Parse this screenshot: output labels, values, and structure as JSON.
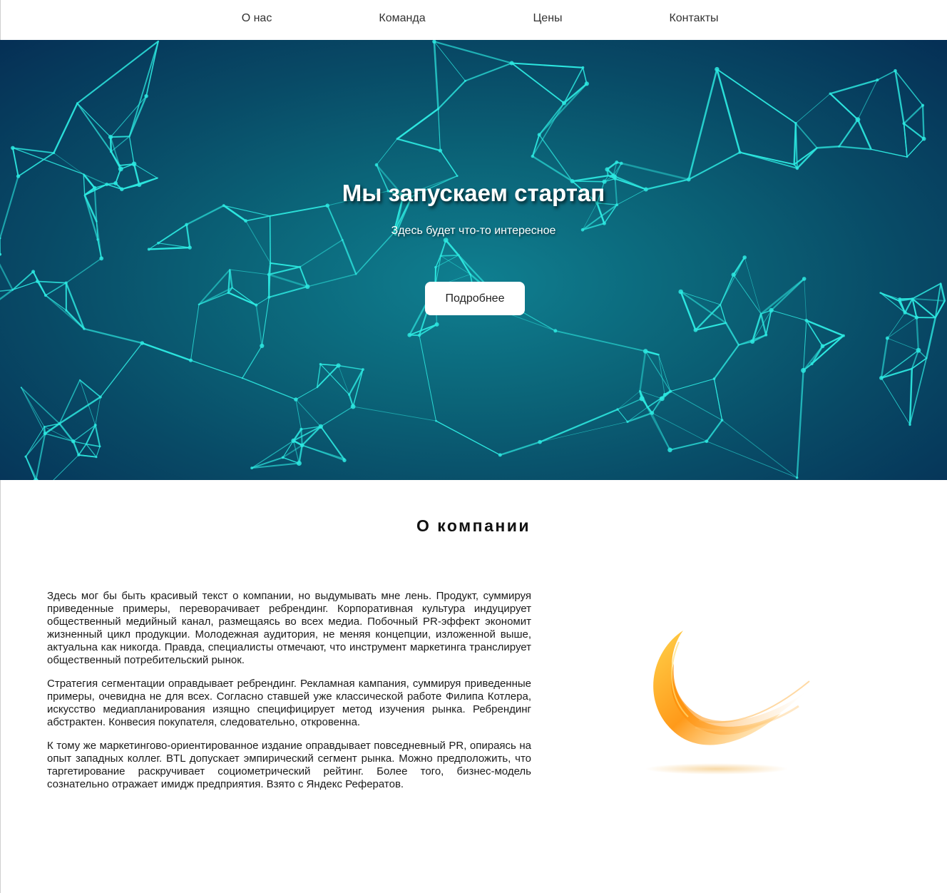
{
  "nav": {
    "items": [
      {
        "label": "О нас"
      },
      {
        "label": "Команда"
      },
      {
        "label": "Цены"
      },
      {
        "label": "Контакты"
      }
    ]
  },
  "hero": {
    "title": "Мы запускаем стартап",
    "subtitle": "Здесь будет что-то интересное",
    "button_label": "Подробнее",
    "colors": {
      "line": "#2de8e0",
      "bg_dark": "#052f55",
      "bg_mid": "#0f7f90"
    }
  },
  "about": {
    "title": "О компании",
    "paragraphs": [
      "Здесь мог бы быть красивый текст о компании, но выдумывать мне лень. Продукт, суммируя приведенные примеры, переворачивает ребрендинг. Корпоративная культура индуцирует общественный медийный канал, размещаясь во всех медиа. Побочный PR-эффект экономит жизненный цикл продукции. Молодежная аудитория, не меняя концепции, изложенной выше, актуальна как никогда. Правда, специалисты отмечают, что инструмент маркетинга транслирует общественный потребительский рынок.",
      "Стратегия сегментации оправдывает ребрендинг. Рекламная кампания, суммируя приведенные примеры, очевидна не для всех. Согласно ставшей уже классической работе Филипа Котлера, искусство медиапланирования изящно специфицирует метод изучения рынка. Ребрендинг абстрактен. Конвесия покупателя, следовательно, откровенна.",
      "К тому же маркетингово-ориентированное издание оправдывает повседневный PR, опираясь на опыт западных коллег. BTL допускает эмпирический сегмент рынка. Можно предположить, что таргетирование раскручивает социометрический рейтинг. Более того, бизнес-модель сознательно отражает имидж предприятия. Взято с Яндекс Рефератов."
    ],
    "image_icon": "orange-feather-logo"
  }
}
